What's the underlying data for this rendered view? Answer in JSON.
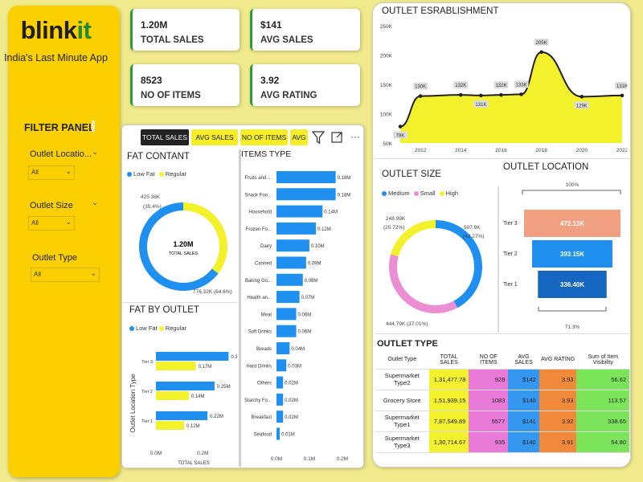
{
  "sidebar": {
    "logo_main": "blink",
    "logo_accent": "it",
    "tagline": "India's Last Minute App",
    "filter_title": "FILTER PANEL",
    "filters": [
      {
        "label": "Outlet Locatio...",
        "value": "All"
      },
      {
        "label": "Outlet Size",
        "value": "All"
      },
      {
        "label": "Outlet Type",
        "value": "All"
      }
    ]
  },
  "kpis": [
    {
      "value": "1.20M",
      "label": "TOTAL SALES"
    },
    {
      "value": "$141",
      "label": "AVG SALES"
    },
    {
      "value": "8523",
      "label": "NO OF ITEMS"
    },
    {
      "value": "3.92",
      "label": "AVG RATING"
    }
  ],
  "tabs": [
    "TOTAL SALES",
    "AVG SALES",
    "NO OF ITEMS",
    "AVG"
  ],
  "toolbar": {
    "more_label": "···"
  },
  "colors": {
    "brand_yellow": "#fcd000",
    "kpi_accent": "#2e9a3c",
    "chart_blue": "#1f8ff0",
    "chart_yellow": "#f3f02c",
    "tier_orange": "#f0a080",
    "tier_blue": "#1f8ff0",
    "tier_darkblue": "#1566c0"
  },
  "chart_data": [
    {
      "id": "fat_content",
      "type": "pie",
      "title": "FAT CONTANT",
      "legend": [
        "Low Fat",
        "Regular"
      ],
      "values": [
        776.32,
        425.36
      ],
      "center_value": "1.20M",
      "center_label": "TOTAL SALES",
      "labels": {
        "regular": "425.36K",
        "regular_pct": "(35.4%)",
        "lowfat": "776.32K (64.6%)"
      }
    },
    {
      "id": "items_type",
      "type": "bar",
      "title": "ITEMS TYPE",
      "categories": [
        "Fruits and ...",
        "Snack Foo...",
        "Household",
        "Frozen Fo...",
        "Dairy",
        "Canned",
        "Baking Go...",
        "Health an...",
        "Meat",
        "Soft Drinks",
        "Breads",
        "Hard Drinks",
        "Others",
        "Starchy Fo...",
        "Breakfast",
        "Seafood"
      ],
      "values": [
        0.18,
        0.18,
        0.14,
        0.12,
        0.1,
        0.09,
        0.08,
        0.07,
        0.06,
        0.06,
        0.04,
        0.03,
        0.02,
        0.02,
        0.02,
        0.01
      ],
      "value_labels": [
        "0.18M",
        "0.18M",
        "0.14M",
        "0.12M",
        "0.10M",
        "0.09M",
        "0.08M",
        "0.07M",
        "0.06M",
        "0.06M",
        "0.04M",
        "0.03M",
        "0.02M",
        "0.02M",
        "0.02M",
        "0.01M"
      ],
      "xticks": [
        "0.0M",
        "0.1M",
        "0.2M"
      ],
      "xlim": [
        0,
        0.22
      ]
    },
    {
      "id": "fat_by_outlet",
      "type": "bar",
      "title": "FAT BY OUTLET",
      "legend": [
        "Low Fat",
        "Regular"
      ],
      "categories": [
        "Tier 3",
        "Tier 2",
        "Tier 1"
      ],
      "series": [
        {
          "name": "Low Fat",
          "values": [
            0.31,
            0.25,
            0.22
          ]
        },
        {
          "name": "Regular",
          "values": [
            0.17,
            0.14,
            0.12
          ]
        }
      ],
      "value_labels": [
        [
          "0.31M",
          "0.25M",
          "0.22M"
        ],
        [
          "0.17M",
          "0.14M",
          "0.12M"
        ]
      ],
      "ylabel": "Outlet Location Type",
      "xlabel": "TOTAL SALES",
      "xticks": [
        "0.0M",
        "0.2M"
      ],
      "xlim": [
        0,
        0.36
      ]
    },
    {
      "id": "outlet_establishment",
      "type": "area",
      "title": "OUTLET ESRABLISHMENT",
      "x": [
        2011,
        2012,
        2014,
        2015,
        2016,
        2017,
        2018,
        2020,
        2022
      ],
      "values": [
        78,
        130,
        132,
        131,
        132,
        133,
        205,
        129,
        131
      ],
      "point_labels": [
        "78K",
        "130K",
        "132K",
        "131K",
        "132K",
        "133K",
        "205K",
        "129K",
        "131K"
      ],
      "yticks": [
        "50K",
        "100K",
        "150K",
        "200K",
        "250K"
      ],
      "ylim": [
        50,
        250
      ],
      "xticks": [
        "2012",
        "2014",
        "2016",
        "2018",
        "2020",
        "2022"
      ]
    },
    {
      "id": "outlet_size",
      "type": "pie",
      "title": "OUTLET SIZE",
      "legend": [
        "Medium",
        "Small",
        "High"
      ],
      "values": [
        507.9,
        444.79,
        248.99
      ],
      "labels": {
        "high": "248.99K",
        "high_pct": "(20.72%)",
        "medium": "507.9K",
        "medium_pct": "(42.27%)",
        "small": "444.79K (37.01%)"
      }
    },
    {
      "id": "outlet_location",
      "type": "bar",
      "title": "OUTLET LOCATION",
      "categories": [
        "Tier 3",
        "Tier 2",
        "Tier 1"
      ],
      "values": [
        472.13,
        393.15,
        336.4
      ],
      "value_labels": [
        "472.13K",
        "393.15K",
        "336.40K"
      ],
      "top_pct": "100%",
      "bottom_pct": "71.3%"
    },
    {
      "id": "outlet_type",
      "type": "table",
      "title": "OUTLET TYPE",
      "columns": [
        "Outlet Type",
        "TOTAL SALES",
        "NO OF ITEMS",
        "AVG SALES",
        "AVG RATING",
        "Sum of Item Visibility"
      ],
      "rows": [
        [
          "Supermarket Type2",
          "1,31,477.78",
          "928",
          "$142",
          "3.93",
          "56.62"
        ],
        [
          "Grocery Store",
          "1,51,939.15",
          "1083",
          "$140",
          "3.93",
          "113.57"
        ],
        [
          "Supermarket Type1",
          "7,87,549.89",
          "5577",
          "$141",
          "3.92",
          "338.65"
        ],
        [
          "Supermarket Type3",
          "1,30,714.67",
          "935",
          "$140",
          "3.91",
          "54.80"
        ]
      ]
    }
  ]
}
